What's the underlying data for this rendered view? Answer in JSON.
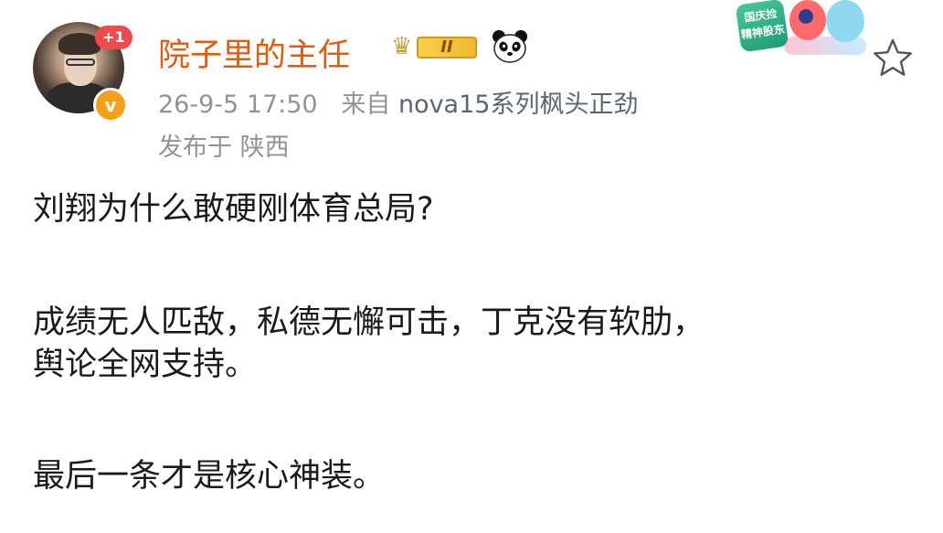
{
  "post": {
    "author": {
      "name": "院子里的主任",
      "notification_count": "+1",
      "verified_mark": "v",
      "level_badge": "II",
      "badge_icon": "crown-icon",
      "emoji_icon": "panda-icon"
    },
    "meta": {
      "timestamp": "26-9-5 17:50",
      "source_prefix": "来自",
      "device": "nova15系列枫头正劲",
      "location": "发布于 陕西"
    },
    "promo": {
      "text_line1": "国庆捡",
      "text_line2": "精神股东"
    },
    "favorite_icon": "star-icon",
    "content": {
      "line1": "刘翔为什么敢硬刚体育总局?",
      "line2": "成绩无人匹敌，私德无懈可击，丁克没有软肋，",
      "line3": "舆论全网支持。",
      "line4": "最后一条才是核心神装。"
    }
  },
  "colors": {
    "username": "#e35b0c",
    "meta": "#939393",
    "device": "#57677a",
    "verified": "#f6a019",
    "badge_plus": "#f04a4a"
  }
}
